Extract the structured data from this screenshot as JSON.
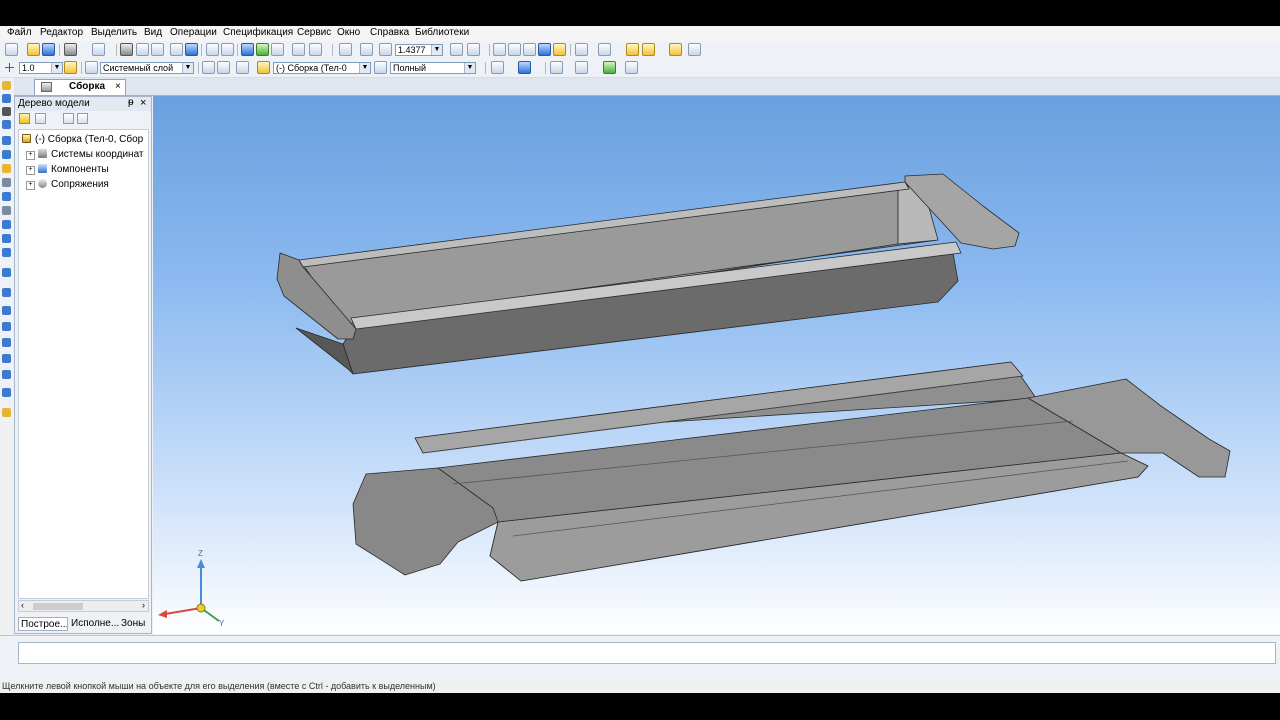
{
  "menu": [
    "Файл",
    "Редактор",
    "Выделить",
    "Вид",
    "Операции",
    "Спецификация",
    "Сервис",
    "Окно",
    "Справка",
    "Библиотеки"
  ],
  "toolbar": {
    "zoom_value": "1.4377",
    "line_scale": "1.0",
    "layer": "Системный слой",
    "assembly": "(-) Сборка (Тел-0",
    "display_mode": "Полный"
  },
  "tab": {
    "label": "Сборка",
    "close": "×"
  },
  "tree_panel": {
    "title": "Дерево модели",
    "pin": "ᵽ",
    "close": "×",
    "items": [
      {
        "label": "(-) Сборка (Тел-0, Сбор",
        "icon": "assembly-icon"
      },
      {
        "label": "Системы координат",
        "icon": "coordinate-systems-icon"
      },
      {
        "label": "Компоненты",
        "icon": "components-icon"
      },
      {
        "label": "Сопряжения",
        "icon": "constraints-icon"
      }
    ],
    "bottom_tabs": [
      "Построе...",
      "Исполне...",
      "Зоны"
    ]
  },
  "axes": {
    "z": "Z",
    "y": "Y"
  },
  "status": "Щелкните левой кнопкой мыши на объекте для его выделения (вместе с Ctrl - добавить к выделенным)",
  "colors": {
    "accent": "#f2c33a",
    "viewport_top": "#6aa0df",
    "part_gray": "#8e8e8e"
  }
}
